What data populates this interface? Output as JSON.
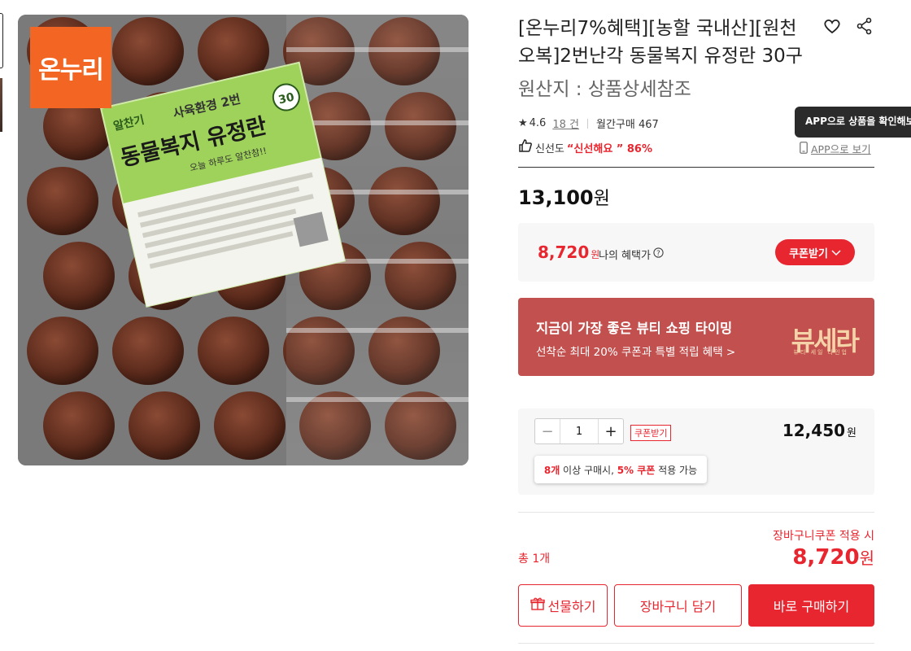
{
  "product": {
    "title": "[온누리7%혜택][농할 국내산][원천오복]2번난각 동물복지 유정란 30구",
    "origin": "원산지 : 상품상세참조",
    "rating": "4.6",
    "review_count": "18 건",
    "monthly_sales": "월간구매 467",
    "freshness_label": "신선도",
    "freshness_grade": "“신선해요 ” 86%",
    "price": "13,100",
    "price_unit": "원"
  },
  "image": {
    "logo_text": "온누리",
    "label_brand": "알찬기",
    "label_line1": "사육환경 2번",
    "label_main": "동물복지 유정란",
    "label_count": "30",
    "label_sub": "오늘 하루도 알찬참!!"
  },
  "app": {
    "tooltip": "APP으로 상품을 확인해보세요",
    "link": "APP으로 보기"
  },
  "benefit": {
    "price": "8,720",
    "unit": "원",
    "label": "나의 혜택가",
    "coupon_button": "쿠폰받기"
  },
  "banner": {
    "title": "지금이 가장 좋은 뷰티 쇼핑 타이밍",
    "subtitle": "선착순 최대 20% 쿠폰과 특별 적립 혜택 >",
    "logo": "뷰세라",
    "logo_sub": "뷰티 세일 라인업"
  },
  "option": {
    "quantity": "1",
    "coupon_tag": "쿠폰받기",
    "price": "12,450",
    "unit": "원",
    "tip_count": "8개",
    "tip_mid": " 이상 구매시, ",
    "tip_discount": "5% 쿠폰",
    "tip_end": " 적용 가능"
  },
  "summary": {
    "total_label": "총 1개",
    "cart_coupon_text": "장바구니쿠폰 적용 시",
    "total_price": "8,720",
    "unit": "원"
  },
  "actions": {
    "gift": "선물하기",
    "cart": "장바구니 담기",
    "buy": "바로 구매하기"
  },
  "colors": {
    "accent": "#e8262f",
    "banner": "#c2504e",
    "logo_orange": "#f26522"
  }
}
